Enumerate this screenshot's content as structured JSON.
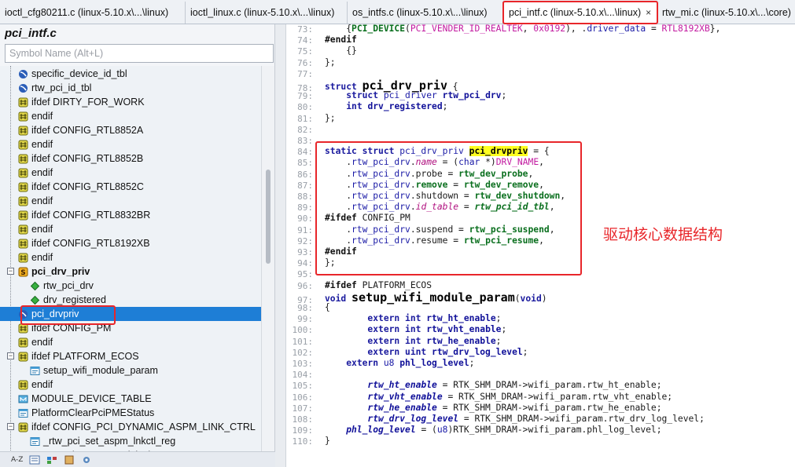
{
  "tabs": [
    {
      "label": "ioctl_cfg80211.c (linux-5.10.x\\...\\linux)"
    },
    {
      "label": "ioctl_linux.c (linux-5.10.x\\...\\linux)"
    },
    {
      "label": "os_intfs.c (linux-5.10.x\\...\\linux)"
    },
    {
      "label": "pci_intf.c (linux-5.10.x\\...\\linux)",
      "active": true,
      "close": "×"
    },
    {
      "label": "rtw_mi.c (linux-5.10.x\\...\\core)"
    }
  ],
  "symbol_panel": {
    "file_title": "pci_intf.c",
    "search_placeholder": "Symbol Name (Alt+L)",
    "items": [
      {
        "label": "specific_device_id_tbl",
        "icon": "struct-var-icon"
      },
      {
        "label": "rtw_pci_id_tbl",
        "icon": "struct-var-icon"
      },
      {
        "label": "ifdef DIRTY_FOR_WORK",
        "icon": "preprocessor-icon"
      },
      {
        "label": "endif",
        "icon": "preprocessor-icon"
      },
      {
        "label": "ifdef CONFIG_RTL8852A",
        "icon": "preprocessor-icon"
      },
      {
        "label": "endif",
        "icon": "preprocessor-icon"
      },
      {
        "label": "ifdef CONFIG_RTL8852B",
        "icon": "preprocessor-icon"
      },
      {
        "label": "endif",
        "icon": "preprocessor-icon"
      },
      {
        "label": "ifdef CONFIG_RTL8852C",
        "icon": "preprocessor-icon"
      },
      {
        "label": "endif",
        "icon": "preprocessor-icon"
      },
      {
        "label": "ifdef CONFIG_RTL8832BR",
        "icon": "preprocessor-icon"
      },
      {
        "label": "endif",
        "icon": "preprocessor-icon"
      },
      {
        "label": "ifdef CONFIG_RTL8192XB",
        "icon": "preprocessor-icon"
      },
      {
        "label": "endif",
        "icon": "preprocessor-icon"
      },
      {
        "label": "pci_drv_priv",
        "icon": "struct-type-icon",
        "bold": true,
        "expanded": true
      },
      {
        "label": "rtw_pci_drv",
        "icon": "member-icon",
        "child": true
      },
      {
        "label": "drv_registered",
        "icon": "member-icon",
        "child": true
      },
      {
        "label": "pci_drvpriv",
        "icon": "struct-var-icon",
        "selected": true
      },
      {
        "label": "ifdef CONFIG_PM",
        "icon": "preprocessor-icon"
      },
      {
        "label": "endif",
        "icon": "preprocessor-icon"
      },
      {
        "label": "ifdef PLATFORM_ECOS",
        "icon": "preprocessor-icon",
        "expanded": true
      },
      {
        "label": "setup_wifi_module_param",
        "icon": "function-icon",
        "child": true
      },
      {
        "label": "endif",
        "icon": "preprocessor-icon"
      },
      {
        "label": "MODULE_DEVICE_TABLE",
        "icon": "macro-icon"
      },
      {
        "label": "PlatformClearPciPMEStatus",
        "icon": "function-icon"
      },
      {
        "label": "ifdef CONFIG_PCI_DYNAMIC_ASPM_LINK_CTRL",
        "icon": "preprocessor-icon",
        "expanded": true
      },
      {
        "label": "_rtw_pci_set_aspm_lnkctl_reg",
        "icon": "function-icon",
        "child": true
      },
      {
        "label": "rtw_pci_set_aspm_lnkctl",
        "icon": "function-icon",
        "child": true
      }
    ],
    "bottom_toolbar": {
      "sort_label": "A-Z"
    }
  },
  "editor": {
    "lines": [
      {
        "n": "73:",
        "parts": [
          [
            "plain",
            "    {"
          ],
          [
            "fnref",
            "PCI_DEVICE"
          ],
          [
            "plain",
            "("
          ],
          [
            "mac",
            "PCI_VENDER_ID_REALTEK"
          ],
          [
            "plain",
            ", "
          ],
          [
            "mac",
            "0x0192"
          ],
          [
            "plain",
            "), ."
          ],
          [
            "var",
            "driver_data"
          ],
          [
            "plain",
            " = "
          ],
          [
            "mac",
            "RTL8192XB"
          ],
          [
            "plain",
            "},"
          ]
        ]
      },
      {
        "n": "74:",
        "parts": [
          [
            "pp",
            "#endif"
          ]
        ]
      },
      {
        "n": "75:",
        "parts": [
          [
            "plain",
            "    {}"
          ]
        ]
      },
      {
        "n": "76:",
        "parts": [
          [
            "plain",
            "};"
          ]
        ]
      },
      {
        "n": "77:",
        "parts": []
      },
      {
        "n": "78:",
        "parts": [
          [
            "kw",
            "struct "
          ],
          [
            "fn",
            "pci_drv_priv"
          ],
          [
            "plain",
            " {"
          ]
        ]
      },
      {
        "n": "79:",
        "parts": [
          [
            "plain",
            "    "
          ],
          [
            "kw",
            "struct "
          ],
          [
            "ty",
            "pci_driver "
          ],
          [
            "var-b",
            "rtw_pci_drv"
          ],
          [
            "plain",
            ";"
          ]
        ]
      },
      {
        "n": "80:",
        "parts": [
          [
            "plain",
            "    "
          ],
          [
            "kw",
            "int "
          ],
          [
            "var-b",
            "drv_registered"
          ],
          [
            "plain",
            ";"
          ]
        ]
      },
      {
        "n": "81:",
        "parts": [
          [
            "plain",
            "};"
          ]
        ]
      },
      {
        "n": "82:",
        "parts": []
      },
      {
        "n": "83:",
        "parts": []
      },
      {
        "n": "84:",
        "parts": [
          [
            "kw",
            "static struct "
          ],
          [
            "ty",
            "pci_drv_priv "
          ],
          [
            "hl",
            "pci_drvpriv"
          ],
          [
            "plain",
            " = {"
          ]
        ]
      },
      {
        "n": "85:",
        "parts": [
          [
            "plain",
            "    ."
          ],
          [
            "var",
            "rtw_pci_drv"
          ],
          [
            "plain",
            "."
          ],
          [
            "mem-i",
            "name"
          ],
          [
            "plain",
            " = ("
          ],
          [
            "ty",
            "char "
          ],
          [
            "plain",
            "*)"
          ],
          [
            "mac",
            "DRV_NAME"
          ],
          [
            "plain",
            ","
          ]
        ]
      },
      {
        "n": "86:",
        "parts": [
          [
            "plain",
            "    ."
          ],
          [
            "var",
            "rtw_pci_drv"
          ],
          [
            "plain",
            ".probe = "
          ],
          [
            "fnref",
            "rtw_dev_probe"
          ],
          [
            "plain",
            ","
          ]
        ]
      },
      {
        "n": "87:",
        "parts": [
          [
            "plain",
            "    ."
          ],
          [
            "var",
            "rtw_pci_drv"
          ],
          [
            "plain",
            "."
          ],
          [
            "fnref",
            "remove"
          ],
          [
            "plain",
            " = "
          ],
          [
            "fnref",
            "rtw_dev_remove"
          ],
          [
            "plain",
            ","
          ]
        ]
      },
      {
        "n": "88:",
        "parts": [
          [
            "plain",
            "    ."
          ],
          [
            "var",
            "rtw_pci_drv"
          ],
          [
            "plain",
            ".shutdown = "
          ],
          [
            "fnref",
            "rtw_dev_shutdown"
          ],
          [
            "plain",
            ","
          ]
        ]
      },
      {
        "n": "89:",
        "parts": [
          [
            "plain",
            "    ."
          ],
          [
            "var",
            "rtw_pci_drv"
          ],
          [
            "plain",
            "."
          ],
          [
            "mem-i",
            "id_table"
          ],
          [
            "plain",
            " = "
          ],
          [
            "fnref-i",
            "rtw_pci_id_tbl"
          ],
          [
            "plain",
            ","
          ]
        ]
      },
      {
        "n": "90:",
        "parts": [
          [
            "pp",
            "#ifdef "
          ],
          [
            "plain",
            "CONFIG_PM"
          ]
        ]
      },
      {
        "n": "91:",
        "parts": [
          [
            "plain",
            "    ."
          ],
          [
            "var",
            "rtw_pci_drv"
          ],
          [
            "plain",
            ".suspend = "
          ],
          [
            "fnref",
            "rtw_pci_suspend"
          ],
          [
            "plain",
            ","
          ]
        ]
      },
      {
        "n": "92:",
        "parts": [
          [
            "plain",
            "    ."
          ],
          [
            "var",
            "rtw_pci_drv"
          ],
          [
            "plain",
            ".resume = "
          ],
          [
            "fnref",
            "rtw_pci_resume"
          ],
          [
            "plain",
            ","
          ]
        ]
      },
      {
        "n": "93:",
        "parts": [
          [
            "pp",
            "#endif"
          ]
        ]
      },
      {
        "n": "94:",
        "parts": [
          [
            "plain",
            "};"
          ]
        ]
      },
      {
        "n": "95:",
        "parts": []
      },
      {
        "n": "96:",
        "parts": [
          [
            "pp",
            "#ifdef "
          ],
          [
            "plain",
            "PLATFORM_ECOS"
          ]
        ]
      },
      {
        "n": "97:",
        "parts": [
          [
            "kw",
            "void "
          ],
          [
            "fn",
            "setup_wifi_module_param"
          ],
          [
            "plain",
            "("
          ],
          [
            "kw",
            "void"
          ],
          [
            "plain",
            ")"
          ]
        ]
      },
      {
        "n": "98:",
        "parts": [
          [
            "plain",
            "{"
          ]
        ]
      },
      {
        "n": "99:",
        "parts": [
          [
            "plain",
            "        "
          ],
          [
            "kw",
            "extern int "
          ],
          [
            "var-b",
            "rtw_ht_enable"
          ],
          [
            "plain",
            ";"
          ]
        ]
      },
      {
        "n": "100:",
        "parts": [
          [
            "plain",
            "        "
          ],
          [
            "kw",
            "extern int "
          ],
          [
            "var-b",
            "rtw_vht_enable"
          ],
          [
            "plain",
            ";"
          ]
        ]
      },
      {
        "n": "101:",
        "parts": [
          [
            "plain",
            "        "
          ],
          [
            "kw",
            "extern int "
          ],
          [
            "var-b",
            "rtw_he_enable"
          ],
          [
            "plain",
            ";"
          ]
        ]
      },
      {
        "n": "102:",
        "parts": [
          [
            "plain",
            "        "
          ],
          [
            "kw",
            "extern uint "
          ],
          [
            "var-b",
            "rtw_drv_log_level"
          ],
          [
            "plain",
            ";"
          ]
        ]
      },
      {
        "n": "103:",
        "parts": [
          [
            "plain",
            "    "
          ],
          [
            "kw",
            "extern "
          ],
          [
            "ty",
            "u8 "
          ],
          [
            "var-b",
            "phl_log_level"
          ],
          [
            "plain",
            ";"
          ]
        ]
      },
      {
        "n": "104:",
        "parts": []
      },
      {
        "n": "105:",
        "parts": [
          [
            "plain",
            "        "
          ],
          [
            "var-bi",
            "rtw_ht_enable"
          ],
          [
            "plain",
            " = RTK_SHM_DRAM->wifi_param.rtw_ht_enable;"
          ]
        ]
      },
      {
        "n": "106:",
        "parts": [
          [
            "plain",
            "        "
          ],
          [
            "var-bi",
            "rtw_vht_enable"
          ],
          [
            "plain",
            " = RTK_SHM_DRAM->wifi_param.rtw_vht_enable;"
          ]
        ]
      },
      {
        "n": "107:",
        "parts": [
          [
            "plain",
            "        "
          ],
          [
            "var-bi",
            "rtw_he_enable"
          ],
          [
            "plain",
            " = RTK_SHM_DRAM->wifi_param.rtw_he_enable;"
          ]
        ]
      },
      {
        "n": "108:",
        "parts": [
          [
            "plain",
            "        "
          ],
          [
            "var-bi",
            "rtw_drv_log_level"
          ],
          [
            "plain",
            " = RTK_SHM_DRAM->wifi_param.rtw_drv_log_level;"
          ]
        ]
      },
      {
        "n": "109:",
        "parts": [
          [
            "plain",
            "    "
          ],
          [
            "var-bi",
            "phl_log_level"
          ],
          [
            "plain",
            " = ("
          ],
          [
            "ty",
            "u8"
          ],
          [
            "plain",
            ")RTK_SHM_DRAM->wifi_param.phl_log_level;"
          ]
        ]
      },
      {
        "n": "110:",
        "parts": [
          [
            "plain",
            "}"
          ]
        ]
      }
    ],
    "annotation": "驱动核心数据结构"
  },
  "colors": {
    "highlight": "#ffff20",
    "selection": "#1e7ed6",
    "annotation_red": "#e8262a"
  }
}
